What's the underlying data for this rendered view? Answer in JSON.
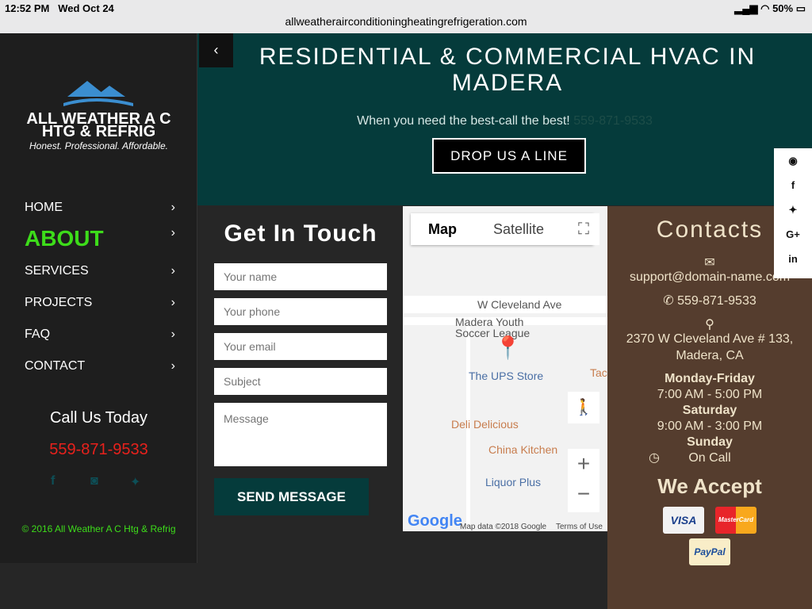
{
  "status": {
    "time": "12:52 PM",
    "date": "Wed Oct 24",
    "url": "allweatherairconditioningheatingrefrigeration.com",
    "battery": "50%"
  },
  "logo": {
    "line1": "ALL WEATHER A C",
    "line2": "HTG & REFRIG",
    "tagline": "Honest. Professional. Affordable."
  },
  "nav": [
    {
      "label": "HOME"
    },
    {
      "label": "ABOUT"
    },
    {
      "label": "SERVICES"
    },
    {
      "label": "PROJECTS"
    },
    {
      "label": "FAQ"
    },
    {
      "label": "CONTACT"
    }
  ],
  "sidebar": {
    "call_label": "Call Us Today",
    "phone": "559-871-9533",
    "copyright": "© 2016 All Weather A C Htg & Refrig"
  },
  "hero": {
    "title": "RESIDENTIAL & COMMERCIAL HVAC IN MADERA",
    "subtitle": "When you need the best-call the best!",
    "phone": "559-871-9533",
    "cta": "DROP US A LINE"
  },
  "form": {
    "title": "Get In Touch",
    "name": "Your name",
    "phone": "Your phone",
    "email": "Your email",
    "subject": "Subject",
    "message": "Message",
    "submit": "SEND MESSAGE"
  },
  "map": {
    "tab_map": "Map",
    "tab_satellite": "Satellite",
    "street": "W Cleveland Ave",
    "places": [
      "Madera Youth Soccer League",
      "The UPS Store",
      "Deli Delicious",
      "China Kitchen",
      "Liquor Plus",
      "Tac"
    ],
    "attribution": "Map data ©2018 Google",
    "terms": "Terms of Use",
    "logo": "Google"
  },
  "contacts": {
    "title": "Contacts",
    "email": "support@domain-name.com",
    "phone": "559-871-9533",
    "address1": "2370 W Cleveland Ave # 133,",
    "address2": "Madera, CA",
    "hours": [
      {
        "day": "Monday-Friday",
        "time": "7:00 AM - 5:00 PM"
      },
      {
        "day": "Saturday",
        "time": "9:00 AM - 3:00 PM"
      },
      {
        "day": "Sunday",
        "time": "On Call"
      }
    ],
    "accept": "We Accept",
    "cards": [
      "VISA",
      "MasterCard",
      "PayPal"
    ]
  }
}
